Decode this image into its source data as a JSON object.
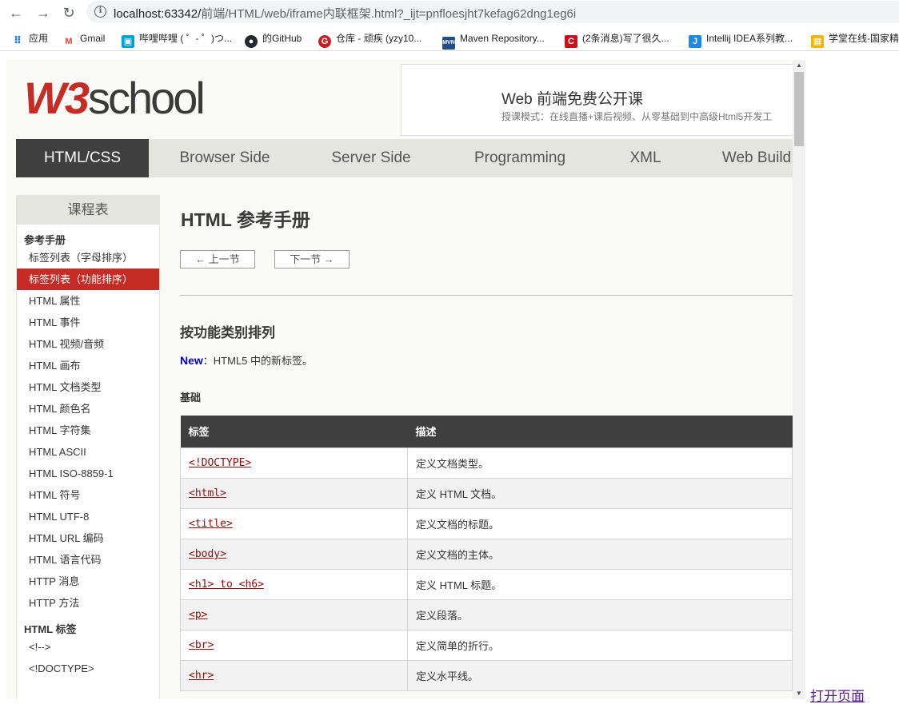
{
  "browser": {
    "url_host": "localhost:63342/",
    "url_rest": "前端/HTML/web/iframe内联框架.html?_ijt=pnfloesjht7kefag62dng1eg6i",
    "bookmarks": [
      {
        "label": "应用",
        "icon": "apps-grid-icon",
        "color": "#1a73e8"
      },
      {
        "label": "Gmail",
        "icon": "gmail-icon",
        "color": "#ea4335"
      },
      {
        "label": "哔哩哔哩 ( ゜- ゜)つ...",
        "icon": "bilibili-icon",
        "color": "#00a1d6"
      },
      {
        "label": "的GitHub",
        "icon": "github-icon",
        "color": "#24292e"
      },
      {
        "label": "仓库 - 顽疾 (yzy10...",
        "icon": "gitee-icon",
        "color": "#c71d23"
      },
      {
        "label": "Maven Repository...",
        "icon": "maven-icon",
        "color": "#1f4e8c"
      },
      {
        "label": "(2条消息)写了很久...",
        "icon": "csdn-icon",
        "color": "#c9121e"
      },
      {
        "label": "Intellij IDEA系列教...",
        "icon": "jetbrains-icon",
        "color": "#1e88e5"
      },
      {
        "label": "学堂在线-国家精",
        "icon": "xuetang-icon",
        "color": "#f4b400"
      }
    ]
  },
  "site": {
    "logo_w3": "W3",
    "logo_school": "school",
    "ad_title": "Web 前端免费公开课",
    "ad_sub": "授课模式：在线直播+课后视频、从零基础到中高级Html5开发工",
    "topnav": [
      "HTML/CSS",
      "Browser Side",
      "Server Side",
      "Programming",
      "XML",
      "Web Build"
    ]
  },
  "sidebar": {
    "title": "课程表",
    "section1": "参考手册",
    "items1": [
      "标签列表（字母排序）",
      "标签列表（功能排序）",
      "HTML 属性",
      "HTML 事件",
      "HTML 视频/音频",
      "HTML 画布",
      "HTML 文档类型",
      "HTML 颜色名",
      "HTML 字符集",
      "HTML ASCII",
      "HTML ISO-8859-1",
      "HTML 符号",
      "HTML UTF-8",
      "HTML URL 编码",
      "HTML 语言代码",
      "HTTP 消息",
      "HTTP 方法"
    ],
    "section2": "HTML 标签",
    "items2": [
      "<!-->",
      "<!DOCTYPE>"
    ]
  },
  "main": {
    "title": "HTML 参考手册",
    "prev": "← 上一节",
    "next": "下一节 →",
    "h2": "按功能类别排列",
    "new_label": "New",
    "new_text": "：HTML5 中的新标签。",
    "h3": "基础",
    "table_headers": [
      "标签",
      "描述"
    ],
    "rows": [
      {
        "tag": "<!DOCTYPE>",
        "desc": "定义文档类型。"
      },
      {
        "tag": "<html>",
        "desc": "定义 HTML 文档。"
      },
      {
        "tag": "<title>",
        "desc": "定义文档的标题。"
      },
      {
        "tag": "<body>",
        "desc": "定义文档的主体。"
      },
      {
        "tag": "<h1> to <h6>",
        "desc": "定义 HTML 标题。"
      },
      {
        "tag": "<p>",
        "desc": "定义段落。"
      },
      {
        "tag": "<br>",
        "desc": "定义简单的折行。"
      },
      {
        "tag": "<hr>",
        "desc": "定义水平线。"
      }
    ]
  },
  "open_link": "打开页面"
}
